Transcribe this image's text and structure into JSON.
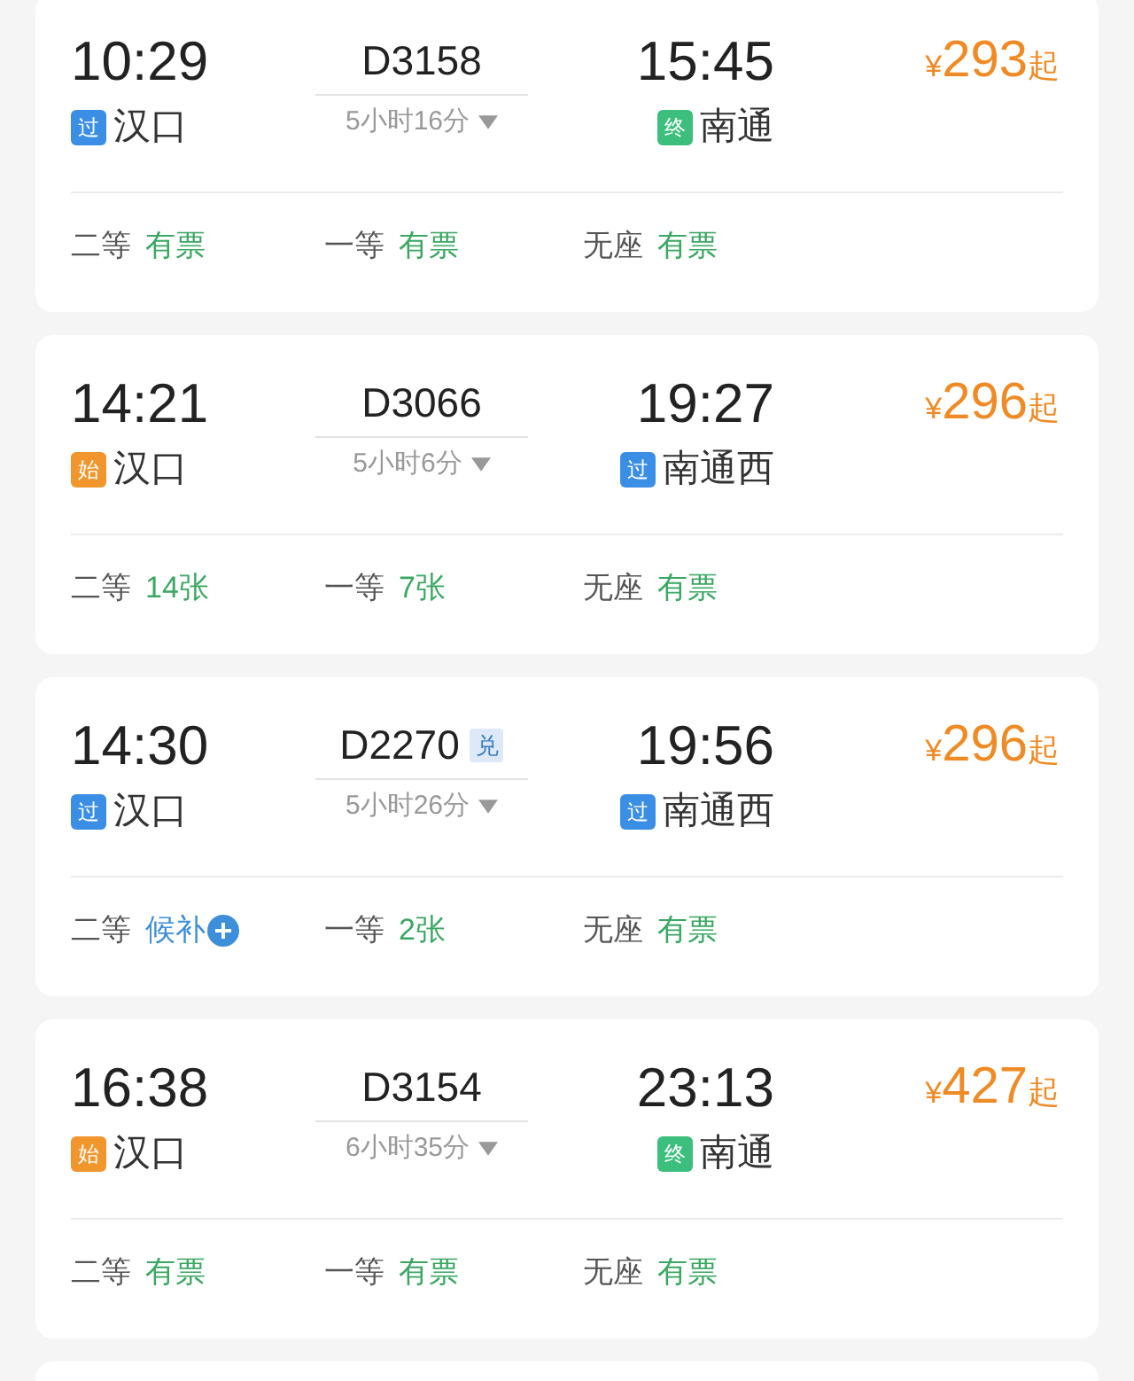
{
  "trains": [
    {
      "dep_time": "10:29",
      "dep_badge": {
        "text": "过",
        "kind": "pass"
      },
      "dep_station": "汉口",
      "train_no": "D3158",
      "duration": "5小时16分",
      "arr_time": "15:45",
      "arr_badge": {
        "text": "终",
        "kind": "end"
      },
      "arr_station": "南通",
      "price": {
        "currency": "¥",
        "amount": "293",
        "suffix": "起"
      },
      "seats": [
        {
          "class": "二等",
          "status": "有票",
          "kind": "available"
        },
        {
          "class": "一等",
          "status": "有票",
          "kind": "available"
        },
        {
          "class": "无座",
          "status": "有票",
          "kind": "available"
        }
      ]
    },
    {
      "dep_time": "14:21",
      "dep_badge": {
        "text": "始",
        "kind": "start"
      },
      "dep_station": "汉口",
      "train_no": "D3066",
      "duration": "5小时6分",
      "arr_time": "19:27",
      "arr_badge": {
        "text": "过",
        "kind": "pass"
      },
      "arr_station": "南通西",
      "price": {
        "currency": "¥",
        "amount": "296",
        "suffix": "起"
      },
      "seats": [
        {
          "class": "二等",
          "status": "14张",
          "kind": "available"
        },
        {
          "class": "一等",
          "status": "7张",
          "kind": "available"
        },
        {
          "class": "无座",
          "status": "有票",
          "kind": "available"
        }
      ]
    },
    {
      "dep_time": "14:30",
      "dep_badge": {
        "text": "过",
        "kind": "pass"
      },
      "dep_station": "汉口",
      "train_no": "D2270",
      "tag": "兑",
      "duration": "5小时26分",
      "arr_time": "19:56",
      "arr_badge": {
        "text": "过",
        "kind": "pass"
      },
      "arr_station": "南通西",
      "price": {
        "currency": "¥",
        "amount": "296",
        "suffix": "起"
      },
      "seats": [
        {
          "class": "二等",
          "status": "候补",
          "kind": "waitlist"
        },
        {
          "class": "一等",
          "status": "2张",
          "kind": "available"
        },
        {
          "class": "无座",
          "status": "有票",
          "kind": "available"
        }
      ]
    },
    {
      "dep_time": "16:38",
      "dep_badge": {
        "text": "始",
        "kind": "start"
      },
      "dep_station": "汉口",
      "train_no": "D3154",
      "duration": "6小时35分",
      "arr_time": "23:13",
      "arr_badge": {
        "text": "终",
        "kind": "end"
      },
      "arr_station": "南通",
      "price": {
        "currency": "¥",
        "amount": "427",
        "suffix": "起"
      },
      "seats": [
        {
          "class": "二等",
          "status": "有票",
          "kind": "available"
        },
        {
          "class": "一等",
          "status": "有票",
          "kind": "available"
        },
        {
          "class": "无座",
          "status": "有票",
          "kind": "available"
        }
      ]
    }
  ]
}
